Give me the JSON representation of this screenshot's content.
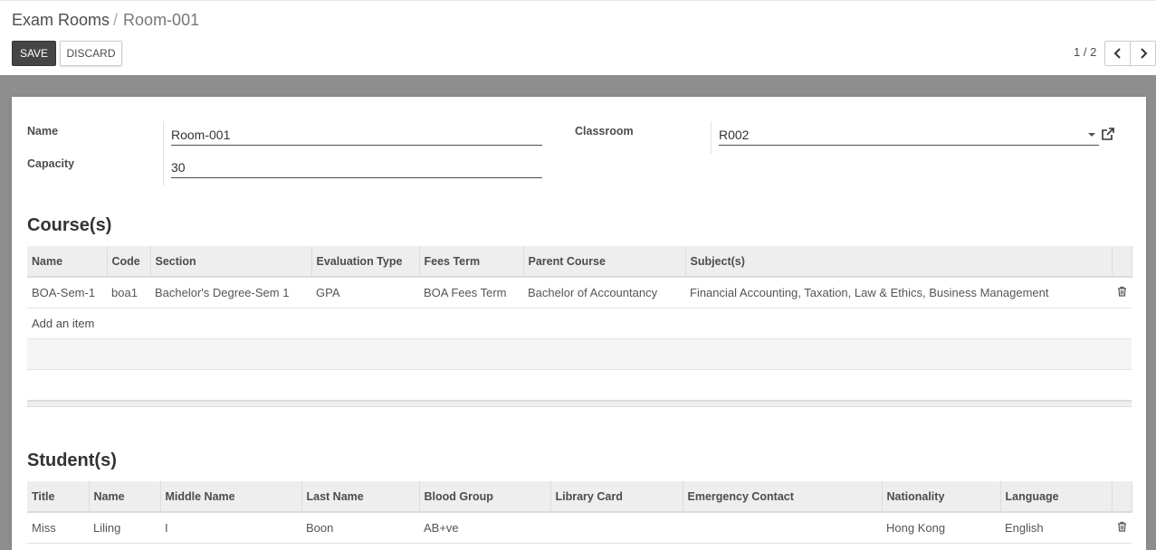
{
  "breadcrumb": {
    "parent": "Exam Rooms",
    "separator": "/",
    "current": "Room-001"
  },
  "toolbar": {
    "save_label": "SAVE",
    "discard_label": "DISCARD"
  },
  "pager": {
    "value": "1 / 2"
  },
  "form": {
    "name_label": "Name",
    "name_value": "Room-001",
    "capacity_label": "Capacity",
    "capacity_value": "30",
    "classroom_label": "Classroom",
    "classroom_value": "R002"
  },
  "courses": {
    "title": "Course(s)",
    "columns": [
      "Name",
      "Code",
      "Section",
      "Evaluation Type",
      "Fees Term",
      "Parent Course",
      "Subject(s)"
    ],
    "rows": [
      [
        "BOA-Sem-1",
        "boa1",
        "Bachelor's Degree-Sem 1",
        "GPA",
        "BOA Fees Term",
        "Bachelor of Accountancy",
        "Financial Accounting, Taxation, Law & Ethics, Business Management"
      ]
    ],
    "add_item": "Add an item"
  },
  "students": {
    "title": "Student(s)",
    "columns": [
      "Title",
      "Name",
      "Middle Name",
      "Last Name",
      "Blood Group",
      "Library Card",
      "Emergency Contact",
      "Nationality",
      "Language"
    ],
    "rows": [
      [
        "Miss",
        "Liling",
        "I",
        "Boon",
        "AB+ve",
        "",
        "",
        "Hong Kong",
        "English"
      ]
    ]
  },
  "colors": {
    "save_bg": "#454545",
    "form_bg": "#8e8e8e",
    "header_bg": "#eeeeee"
  },
  "icons": [
    "chevron-left-icon",
    "chevron-right-icon",
    "external-link-icon",
    "trash-icon",
    "dropdown-caret-icon"
  ]
}
